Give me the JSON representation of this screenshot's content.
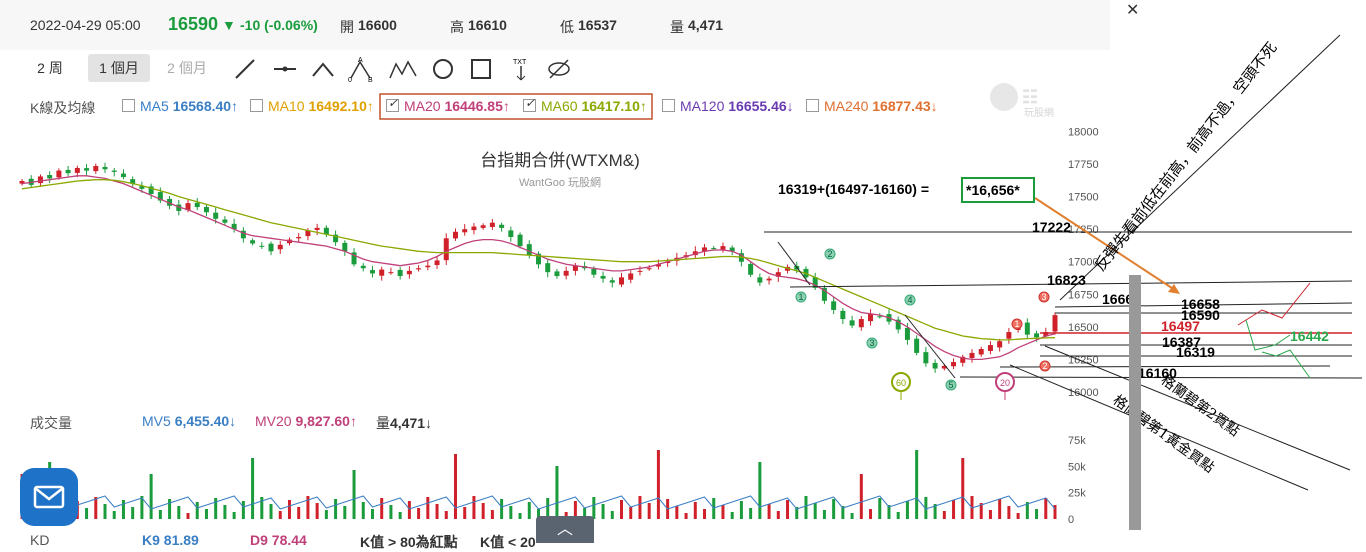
{
  "quote": {
    "datetime": "2022-04-29 05:00",
    "price": "16590",
    "change": "-10 (-0.06%)",
    "open_label": "開",
    "open": "16600",
    "high_label": "高",
    "high": "16610",
    "low_label": "低",
    "low": "16537",
    "vol_label": "量",
    "vol": "4,471"
  },
  "toolbar": {
    "periods": [
      "2 周",
      "1 個月",
      "2 個月"
    ],
    "active_period": "1 個月",
    "tools": [
      "line-tool-icon",
      "horizontal-line-icon",
      "angle-icon",
      "abc-pattern-icon",
      "abcd-pattern-icon",
      "circle-icon",
      "rectangle-icon",
      "text-tool-icon",
      "hide-icon"
    ],
    "txt_label": "TXT"
  },
  "ma_legend": {
    "title": "K線及均線",
    "items": [
      {
        "label": "MA5",
        "value": "16568.40↑",
        "checked": false,
        "color": "#3a7ec4"
      },
      {
        "label": "MA10",
        "value": "16492.10↑",
        "checked": false,
        "color": "#e0a000"
      },
      {
        "label": "MA20",
        "value": "16446.85↑",
        "checked": true,
        "color": "#c0407a"
      },
      {
        "label": "MA60",
        "value": "16417.10↑",
        "checked": true,
        "color": "#8aa800"
      },
      {
        "label": "MA120",
        "value": "16655.46↓",
        "checked": false,
        "color": "#6a3bb0"
      },
      {
        "label": "MA240",
        "value": "16877.43↓",
        "checked": false,
        "color": "#e07030"
      }
    ]
  },
  "watermark": {
    "brand": "玩股網",
    "sub": "WantGoo 玩股網"
  },
  "volume_legend": {
    "title": "成交量",
    "mv5_label": "MV5",
    "mv5": "6,455.40↓",
    "mv20_label": "MV20",
    "mv20": "9,827.60↑",
    "vol_label": "量",
    "vol": "4,471↓"
  },
  "kd_legend": {
    "title": "KD",
    "k": "K9 81.89",
    "d": "D9 78.44",
    "note1": "K值 > 80為紅點",
    "note2": "K值 < 20"
  },
  "annotations": {
    "formula": "16319+(16497-16160) = ",
    "target": "*16,656*",
    "levels": [
      "17222",
      "16823",
      "16666",
      "16658",
      "16590",
      "16497",
      "16387",
      "16319",
      "16160",
      "16442"
    ],
    "diag1": "反彈先看前低在前高，前高不過，空頭不死",
    "diag2": "格蘭碧第2買點",
    "diag3": "格蘭碧第1黃金買點",
    "wave_nums": [
      "1",
      "2",
      "3",
      "4",
      "5",
      "1",
      "2",
      "3"
    ],
    "circle60": "60",
    "circle20": "20"
  },
  "chart_data": {
    "type": "candlestick",
    "title": "台指期合併(WTXM&)",
    "subtitle": "WantGoo 玩股網",
    "ylim": [
      15900,
      18050
    ],
    "yticks": [
      "18000",
      "17750",
      "17500",
      "17250",
      "17000",
      "16750",
      "16500",
      "16250",
      "16000"
    ],
    "vol_yticks": [
      "75k",
      "50k",
      "25k",
      "0"
    ],
    "series_close": [
      17620,
      17590,
      17655,
      17640,
      17700,
      17680,
      17720,
      17700,
      17735,
      17710,
      17690,
      17650,
      17600,
      17560,
      17520,
      17470,
      17430,
      17390,
      17450,
      17420,
      17380,
      17330,
      17300,
      17250,
      17180,
      17140,
      17120,
      17080,
      17130,
      17170,
      17190,
      17240,
      17260,
      17210,
      17150,
      17080,
      16980,
      16950,
      16910,
      16940,
      16920,
      16890,
      16930,
      16950,
      16970,
      17010,
      17180,
      17230,
      17250,
      17270,
      17280,
      17300,
      17260,
      17190,
      17120,
      17050,
      16980,
      16920,
      16890,
      16930,
      16970,
      16950,
      16900,
      16870,
      16840,
      16880,
      16910,
      16930,
      16950,
      16980,
      17000,
      17030,
      17050,
      17080,
      17110,
      17100,
      17120,
      17080,
      17000,
      16900,
      16840,
      16870,
      16920,
      16960,
      16940,
      16880,
      16800,
      16700,
      16630,
      16560,
      16510,
      16560,
      16600,
      16580,
      16540,
      16480,
      16400,
      16300,
      16220,
      16180,
      16200,
      16230,
      16270,
      16300,
      16330,
      16360,
      16390,
      16460,
      16520,
      16440,
      16420,
      16460,
      16590
    ],
    "ma20": [
      17600,
      17610,
      17620,
      17630,
      17640,
      17650,
      17660,
      17660,
      17650,
      17640,
      17620,
      17600,
      17570,
      17540,
      17510,
      17480,
      17450,
      17420,
      17400,
      17370,
      17340,
      17310,
      17280,
      17250,
      17220,
      17200,
      17190,
      17180,
      17170,
      17160,
      17150,
      17140,
      17130,
      17120,
      17100,
      17080,
      17050,
      17020,
      17000,
      16990,
      16980,
      16970,
      16980,
      16990,
      17010,
      17040,
      17080,
      17110,
      17140,
      17160,
      17170,
      17170,
      17160,
      17140,
      17110,
      17080,
      17050,
      17020,
      17000,
      16980,
      16970,
      16960,
      16950,
      16940,
      16930,
      16930,
      16940,
      16950,
      16960,
      16980,
      17000,
      17020,
      17040,
      17060,
      17080,
      17090,
      17090,
      17080,
      17050,
      17000,
      16950,
      16910,
      16890,
      16880,
      16870,
      16850,
      16820,
      16780,
      16730,
      16680,
      16640,
      16610,
      16600,
      16590,
      16570,
      16540,
      16500,
      16450,
      16400,
      16350,
      16310,
      16280,
      16260,
      16250,
      16250,
      16260,
      16270,
      16300,
      16340,
      16370,
      16400,
      16430,
      16446
    ],
    "ma60": [
      17560,
      17570,
      17580,
      17590,
      17600,
      17610,
      17620,
      17625,
      17630,
      17630,
      17625,
      17615,
      17600,
      17585,
      17565,
      17545,
      17525,
      17500,
      17480,
      17460,
      17440,
      17420,
      17400,
      17380,
      17360,
      17340,
      17320,
      17300,
      17285,
      17270,
      17255,
      17240,
      17225,
      17210,
      17195,
      17180,
      17165,
      17150,
      17135,
      17120,
      17110,
      17100,
      17090,
      17080,
      17075,
      17070,
      17070,
      17070,
      17070,
      17070,
      17070,
      17070,
      17065,
      17060,
      17055,
      17050,
      17045,
      17040,
      17035,
      17030,
      17025,
      17020,
      17015,
      17010,
      17005,
      17000,
      17000,
      17000,
      17000,
      17005,
      17010,
      17015,
      17020,
      17025,
      17030,
      17035,
      17040,
      17040,
      17035,
      17025,
      17010,
      16990,
      16970,
      16950,
      16930,
      16910,
      16880,
      16850,
      16820,
      16790,
      16760,
      16730,
      16700,
      16670,
      16640,
      16610,
      16580,
      16550,
      16520,
      16490,
      16470,
      16450,
      16430,
      16420,
      16410,
      16405,
      16400,
      16400,
      16405,
      16410,
      16412,
      16415,
      16417
    ]
  }
}
